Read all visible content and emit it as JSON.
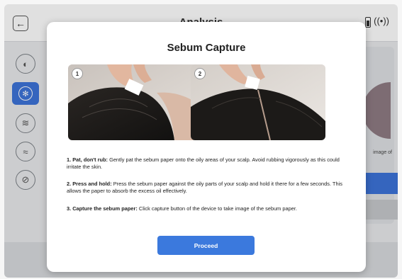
{
  "app": {
    "title": "Analysis"
  },
  "background": {
    "side_text": "image of"
  },
  "modal": {
    "title": "Sebum Capture",
    "images": [
      {
        "badge": "1"
      },
      {
        "badge": "2"
      }
    ],
    "instructions": [
      {
        "bold": "1. Pat, don't rub:",
        "text": " Gently pat the sebum paper onto the oily areas of your scalp. Avoid rubbing vigorously as this could irritate the skin."
      },
      {
        "bold": "2. Press and hold:",
        "text": " Press the sebum paper against the oily parts of your scalp and hold it there for a few seconds. This allows the paper to absorb the excess oil effectively."
      },
      {
        "bold": "3. Capture the sebum paper:",
        "text": " Click capture button of the device to take image of the sebum paper."
      }
    ],
    "proceed_label": "Proceed"
  },
  "colors": {
    "accent": "#3b79dd",
    "active_nav": "#3d73d9"
  }
}
